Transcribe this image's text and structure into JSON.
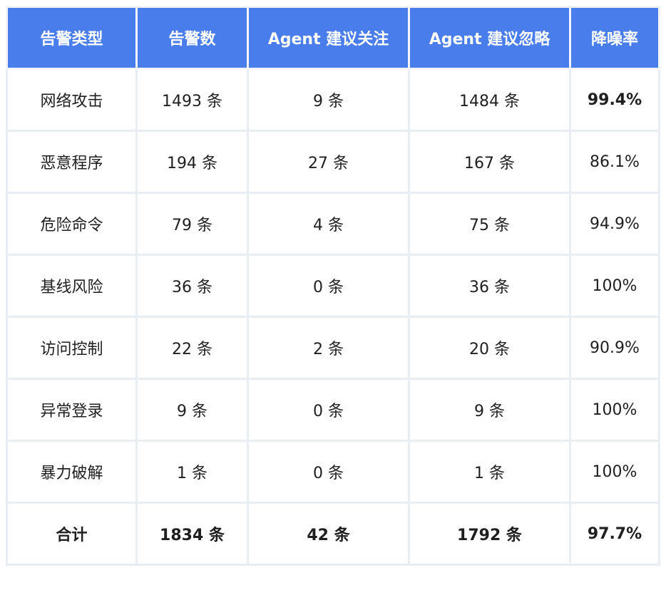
{
  "table": {
    "headers": [
      "告警类型",
      "告警数",
      "Agent 建议关注",
      "Agent 建议忽略",
      "降噪率"
    ],
    "rows": [
      [
        "网络攻击",
        "1493 条",
        "9 条",
        "1484 条",
        "99.4%"
      ],
      [
        "恶意程序",
        "194 条",
        "27 条",
        "167 条",
        "86.1%"
      ],
      [
        "危险命令",
        "79 条",
        "4 条",
        "75 条",
        "94.9%"
      ],
      [
        "基线风险",
        "36 条",
        "0 条",
        "36 条",
        "100%"
      ],
      [
        "访问控制",
        "22 条",
        "2 条",
        "20 条",
        "90.9%"
      ],
      [
        "异常登录",
        "9 条",
        "0 条",
        "9 条",
        "100%"
      ],
      [
        "暴力破解",
        "1 条",
        "0 条",
        "1 条",
        "100%"
      ]
    ],
    "total": [
      "合计",
      "1834 条",
      "42 条",
      "1792 条",
      "97.7%"
    ]
  },
  "colors": {
    "header_bg": "#4a7dec",
    "header_text": "#ffffff",
    "grid": "#e9edf4"
  }
}
